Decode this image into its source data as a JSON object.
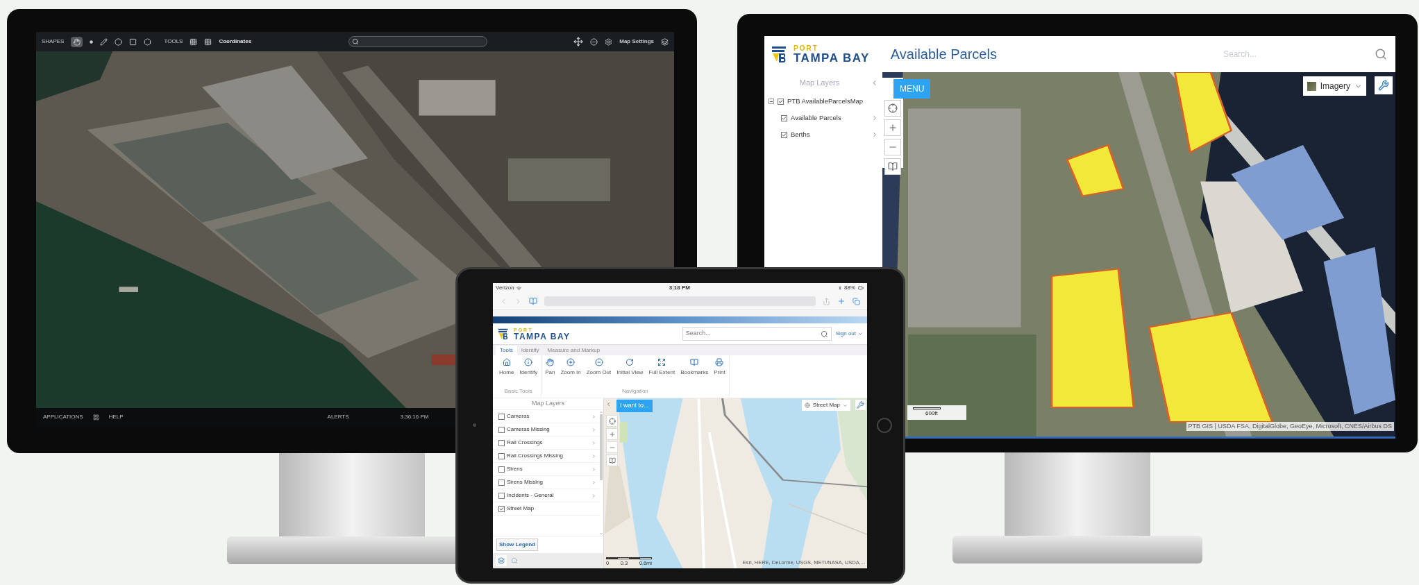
{
  "left_monitor": {
    "toolbar": {
      "shapes_label": "SHAPES",
      "tools_label": "TOOLS",
      "coordinates_label": "Coordinates",
      "settings_label": "Map Settings"
    },
    "status_bar": {
      "applications": "APPLICATIONS",
      "help": "HELP",
      "alerts": "ALERTS",
      "time": "3:36:16 PM"
    }
  },
  "right_monitor": {
    "logo": {
      "line1": "PORT",
      "line2": "TAMPA BAY"
    },
    "title": "Available Parcels",
    "search": {
      "placeholder": "Search..."
    },
    "layers_panel": {
      "title": "Map Layers",
      "tree": [
        {
          "label": "PTB AvailableParcelsMap",
          "checked": true,
          "expanded": true,
          "children": [
            {
              "label": "Available Parcels",
              "checked": true
            },
            {
              "label": "Berths",
              "checked": true
            }
          ]
        }
      ]
    },
    "map": {
      "menu_button": "MENU",
      "basemap": "Imagery",
      "scale": "600ft",
      "attribution": "PTB GIS | USDA FSA, DigitalGlobe, GeoEye, Microsoft, CNES/Airbus DS"
    }
  },
  "tablet": {
    "status_bar": {
      "carrier": "Verizon",
      "time": "3:18 PM",
      "battery": "88%"
    },
    "header": {
      "logo": {
        "line1": "PORT",
        "line2": "TAMPA BAY"
      },
      "search": {
        "placeholder": "Search..."
      },
      "user_menu": "Sign out"
    },
    "tabs": [
      {
        "label": "Tools",
        "selected": true
      },
      {
        "label": "Identify",
        "selected": false
      },
      {
        "label": "Measure and Markup",
        "selected": false
      }
    ],
    "ribbon": [
      {
        "label": "Basic Tools",
        "tools": [
          {
            "label": "Home",
            "kind": "home"
          },
          {
            "label": "Identify",
            "kind": "identify"
          }
        ]
      },
      {
        "label": "Navigation",
        "tools": [
          {
            "label": "Pan",
            "kind": "pan"
          },
          {
            "label": "Zoom In",
            "kind": "zoom_in"
          },
          {
            "label": "Zoom Out",
            "kind": "zoom_out"
          },
          {
            "label": "Initial View",
            "kind": "initial_view"
          },
          {
            "label": "Full Extent",
            "kind": "full_extent"
          },
          {
            "label": "Bookmarks",
            "kind": "bookmarks"
          },
          {
            "label": "Print",
            "kind": "print"
          }
        ]
      }
    ],
    "layers_panel": {
      "title": "Map Layers",
      "layers": [
        {
          "label": "Cameras",
          "checked": false,
          "expandable": true
        },
        {
          "label": "Cameras Missing",
          "checked": false,
          "expandable": true
        },
        {
          "label": "Rail Crossings",
          "checked": false,
          "expandable": true
        },
        {
          "label": "Rail Crossings Missing",
          "checked": false,
          "expandable": true
        },
        {
          "label": "Sirens",
          "checked": false,
          "expandable": true
        },
        {
          "label": "Sirens Missing",
          "checked": false,
          "expandable": true
        },
        {
          "label": "Incidents - General",
          "checked": false,
          "expandable": true
        },
        {
          "label": "Street Map",
          "checked": true,
          "expandable": false
        }
      ],
      "legend_button": "Show Legend"
    },
    "map": {
      "action_button": "I want to...",
      "basemap": "Street Map",
      "scale_labels": [
        "0",
        "0.3",
        "0.6mi"
      ],
      "attribution": "Esri, HERE, DeLorme, USGS, METI/NASA, USDA,..."
    }
  }
}
